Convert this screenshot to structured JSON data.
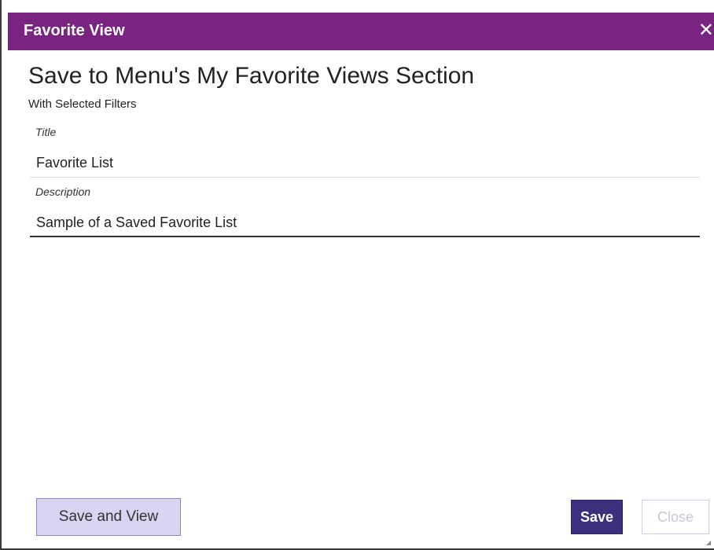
{
  "dialog": {
    "title": "Favorite View",
    "close_icon": "close-icon"
  },
  "content": {
    "heading": "Save to Menu's My Favorite Views Section",
    "subheading": "With Selected Filters"
  },
  "form": {
    "title_label": "Title",
    "title_value": "Favorite List",
    "description_label": "Description",
    "description_value": "Sample of a Saved Favorite List"
  },
  "buttons": {
    "save_and_view": "Save and View",
    "save": "Save",
    "close": "Close"
  },
  "colors": {
    "titlebar": "#7a2482",
    "save_button": "#3b2f7e",
    "save_and_view_button": "#d9d4f1"
  }
}
